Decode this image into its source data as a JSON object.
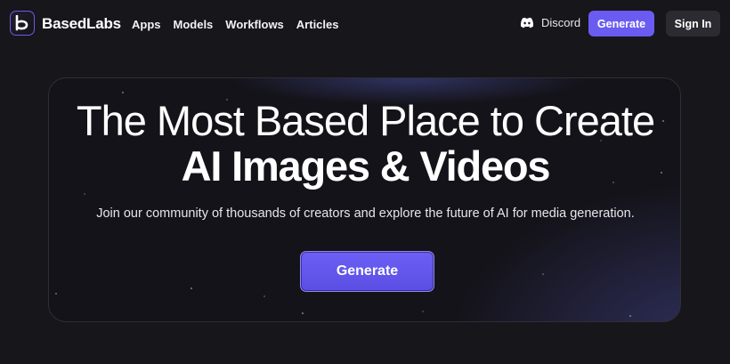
{
  "header": {
    "brand": "BasedLabs",
    "logo_icon": "basedlabs-b-logo",
    "nav": [
      {
        "label": "Apps"
      },
      {
        "label": "Models"
      },
      {
        "label": "Workflows"
      },
      {
        "label": "Articles"
      }
    ],
    "discord_label": "Discord",
    "discord_icon": "discord-icon",
    "generate_label": "Generate",
    "signin_label": "Sign In"
  },
  "hero": {
    "title_line1": "The Most Based Place to Create",
    "title_line2": "AI Images & Videos",
    "subtitle": "Join our community of thousands of creators and explore the future of AI for media generation.",
    "cta_label": "Generate"
  },
  "colors": {
    "background": "#17161b",
    "accent": "#6a5cf0",
    "secondary_button": "#2c2b31"
  }
}
